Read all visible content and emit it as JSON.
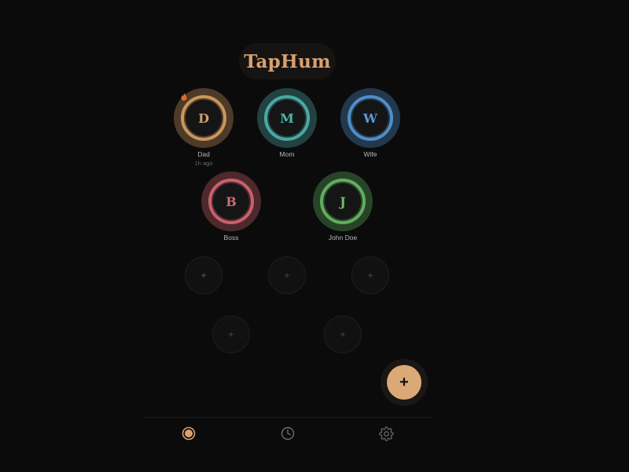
{
  "app": {
    "title": "TapHum"
  },
  "colors": {
    "background": "#0b0b0b",
    "accent": "#d9a070",
    "dad": "#c9965e",
    "mom": "#4aa8a4",
    "wife": "#4f8dc7",
    "boss": "#c8606a",
    "john": "#5fae5f"
  },
  "contacts": [
    {
      "initial": "D",
      "name": "Dad",
      "sub": "1h ago",
      "color": "#c9965e",
      "indicator": "flame-icon"
    },
    {
      "initial": "M",
      "name": "Mom",
      "sub": "",
      "color": "#4aa8a4"
    },
    {
      "initial": "W",
      "name": "Wife",
      "sub": "",
      "color": "#4f8dc7"
    },
    {
      "initial": "B",
      "name": "Boss",
      "sub": "",
      "color": "#c8606a"
    },
    {
      "initial": "J",
      "name": "John Doe",
      "sub": "",
      "color": "#5fae5f"
    }
  ],
  "empty_slots": [
    {
      "label": "+"
    },
    {
      "label": "+"
    },
    {
      "label": "+"
    },
    {
      "label": "+"
    },
    {
      "label": "+"
    }
  ],
  "fab": {
    "label": "+",
    "icon": "plus-icon"
  },
  "nav": [
    {
      "name": "home",
      "icon": "circle-dot-icon",
      "active": true
    },
    {
      "name": "history",
      "icon": "clock-icon",
      "active": false
    },
    {
      "name": "settings",
      "icon": "gear-icon",
      "active": false
    }
  ]
}
